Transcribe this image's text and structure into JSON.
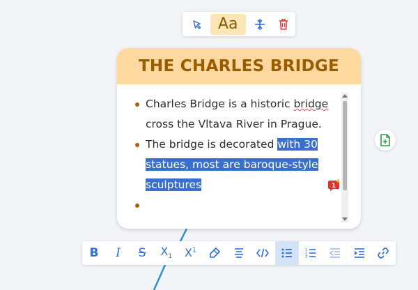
{
  "mini_toolbar": {
    "pointer_icon": "pointer-icon",
    "font_label": "Aa",
    "center_icon": "align-center-vertical-icon",
    "delete_icon": "trash-icon"
  },
  "card": {
    "title": "THE CHARLES BRIDGE",
    "bullets": [
      {
        "text_before": "Charles Bridge is a historic ",
        "text_misspelled": "bridge",
        "text_after": " cross the Vltava River in Prague."
      },
      {
        "text_before": "The bridge is decorated ",
        "text_selected": "with 30 statues, most are baroque-style sculptures"
      },
      {
        "text": ""
      }
    ],
    "comment_badge": "1"
  },
  "side_button_icon": "add-page-icon",
  "format_toolbar": {
    "bold": "B",
    "italic": "I",
    "strike": "S",
    "subscript": "X",
    "subscript_digit": "1",
    "superscript": "X",
    "superscript_digit": "1",
    "active_tool": "bulleted-list"
  },
  "colors": {
    "header_bg": "#fdd9a0",
    "header_text": "#9a5c00",
    "selection": "#3a6fce",
    "toolbar_icon": "#2f6fd6",
    "delete_red": "#e03a3a",
    "add_green": "#2e9a4a"
  }
}
